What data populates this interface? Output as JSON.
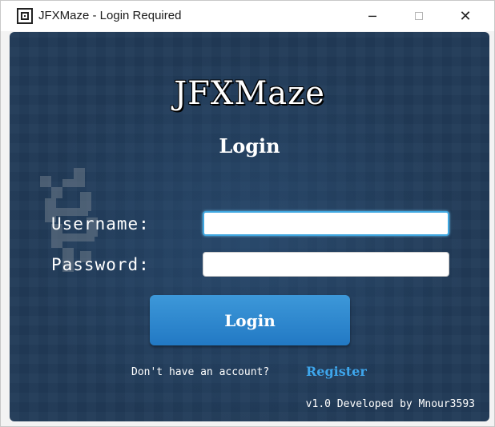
{
  "window": {
    "title": "JFXMaze - Login Required",
    "icon": "maze-icon",
    "controls": {
      "minimize": "─",
      "close": "✕"
    }
  },
  "app": {
    "title": "JFXMaze",
    "subtitle": "Login"
  },
  "form": {
    "username_label": "Username:",
    "username_value": "",
    "password_label": "Password:",
    "password_value": "",
    "login_button": "Login"
  },
  "register": {
    "prompt": "Don't have an account?",
    "link": "Register"
  },
  "footer": {
    "text": "v1.0 Developed by Mnour3593"
  },
  "colors": {
    "background": "#213a57",
    "accent": "#2b86cf",
    "link": "#3ea6ec",
    "focus": "#3fa7e0"
  }
}
